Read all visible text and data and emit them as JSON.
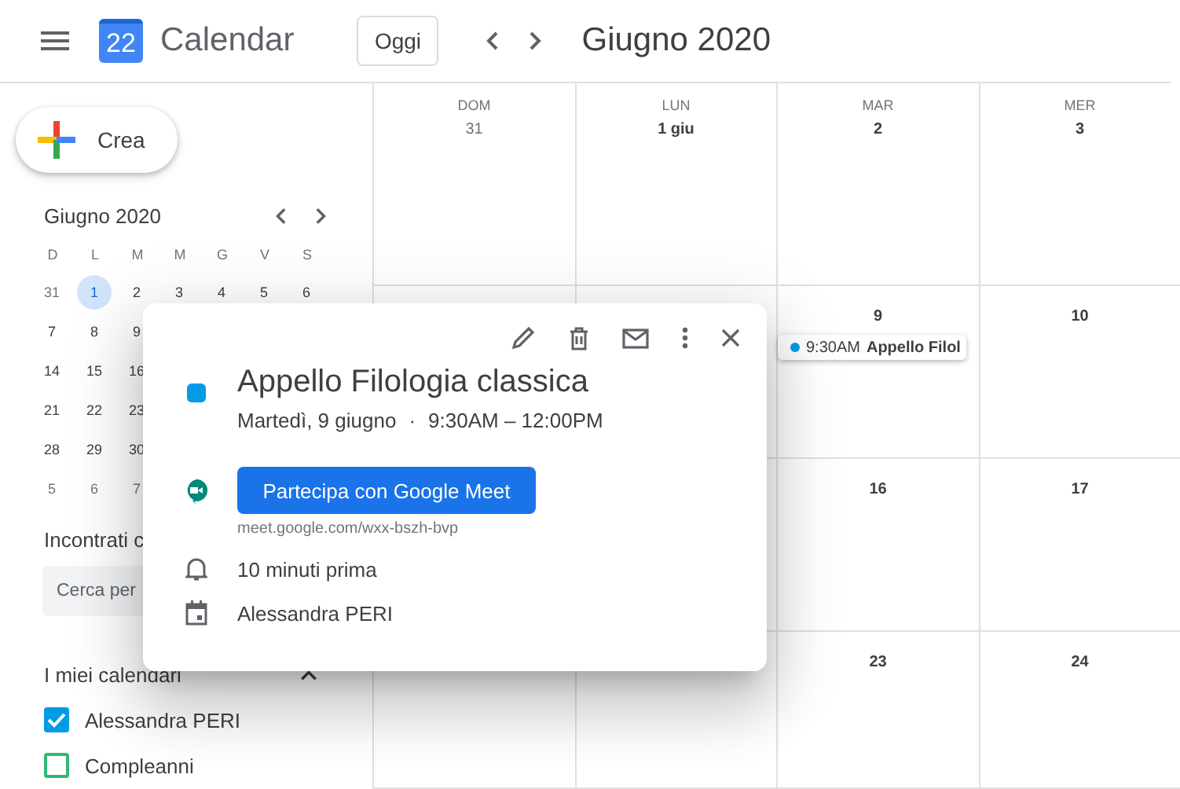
{
  "header": {
    "app_name": "Calendar",
    "logo_day": "22",
    "today_button": "Oggi",
    "title": "Giugno 2020"
  },
  "sidebar": {
    "create_button": "Crea",
    "mini_calendar": {
      "title": "Giugno 2020",
      "weekdays": [
        "D",
        "L",
        "M",
        "M",
        "G",
        "V",
        "S"
      ],
      "weeks": [
        [
          {
            "day": "31",
            "other_month": true,
            "selected": false
          },
          {
            "day": "1",
            "other_month": false,
            "selected": true
          },
          {
            "day": "2",
            "other_month": false,
            "selected": false
          },
          {
            "day": "3",
            "other_month": false,
            "selected": false
          },
          {
            "day": "4",
            "other_month": false,
            "selected": false
          },
          {
            "day": "5",
            "other_month": false,
            "selected": false
          },
          {
            "day": "6",
            "other_month": false,
            "selected": false
          }
        ],
        [
          {
            "day": "7",
            "other_month": false,
            "selected": false
          },
          {
            "day": "8",
            "other_month": false,
            "selected": false
          },
          {
            "day": "9",
            "other_month": false,
            "selected": false
          }
        ],
        [
          {
            "day": "14",
            "other_month": false,
            "selected": false
          },
          {
            "day": "15",
            "other_month": false,
            "selected": false
          },
          {
            "day": "16",
            "other_month": false,
            "selected": false
          }
        ],
        [
          {
            "day": "21",
            "other_month": false,
            "selected": false
          },
          {
            "day": "22",
            "other_month": false,
            "selected": false
          },
          {
            "day": "23",
            "other_month": false,
            "selected": false
          }
        ],
        [
          {
            "day": "28",
            "other_month": false,
            "selected": false
          },
          {
            "day": "29",
            "other_month": false,
            "selected": false
          },
          {
            "day": "30",
            "other_month": false,
            "selected": false
          }
        ],
        [
          {
            "day": "5",
            "other_month": true,
            "selected": false
          },
          {
            "day": "6",
            "other_month": true,
            "selected": false
          },
          {
            "day": "7",
            "other_month": true,
            "selected": false
          }
        ]
      ]
    },
    "meet_heading": "Incontrati c",
    "meet_search": {
      "placeholder": "Cerca per"
    },
    "calendars_heading": "I miei calendari",
    "calendars_expanded": true,
    "calendars": [
      {
        "name": "Alessandra PERI",
        "checked": true,
        "color": "#039be5"
      },
      {
        "name": "Compleanni",
        "checked": false,
        "color": "#33b679"
      }
    ]
  },
  "grid": {
    "rows": [
      [
        {
          "weekday": "DOM",
          "date": "31",
          "other_month": true
        },
        {
          "weekday": "LUN",
          "date": "1 giu",
          "other_month": false
        },
        {
          "weekday": "MAR",
          "date": "2",
          "other_month": false
        },
        {
          "weekday": "MER",
          "date": "3",
          "other_month": false
        }
      ],
      [
        {},
        {},
        {
          "date": "9",
          "other_month": false,
          "events": [
            {
              "time": "9:30AM",
              "title": "Appello Filol",
              "color": "#039be5"
            }
          ]
        },
        {
          "date": "10",
          "other_month": false
        }
      ],
      [
        {},
        {},
        {
          "date": "16",
          "other_month": false
        },
        {
          "date": "17",
          "other_month": false
        }
      ],
      [
        {},
        {},
        {
          "date": "23",
          "other_month": false
        },
        {
          "date": "24",
          "other_month": false
        }
      ]
    ]
  },
  "event_popup": {
    "color": "#039be5",
    "title": "Appello Filologia classica",
    "date": "Martedì, 9 giugno",
    "separator": "·",
    "time": "9:30AM – 12:00PM",
    "meet_button": "Partecipa con Google Meet",
    "meet_link": "meet.google.com/wxx-bszh-bvp",
    "reminder": "10 minuti prima",
    "calendar": "Alessandra PERI"
  }
}
